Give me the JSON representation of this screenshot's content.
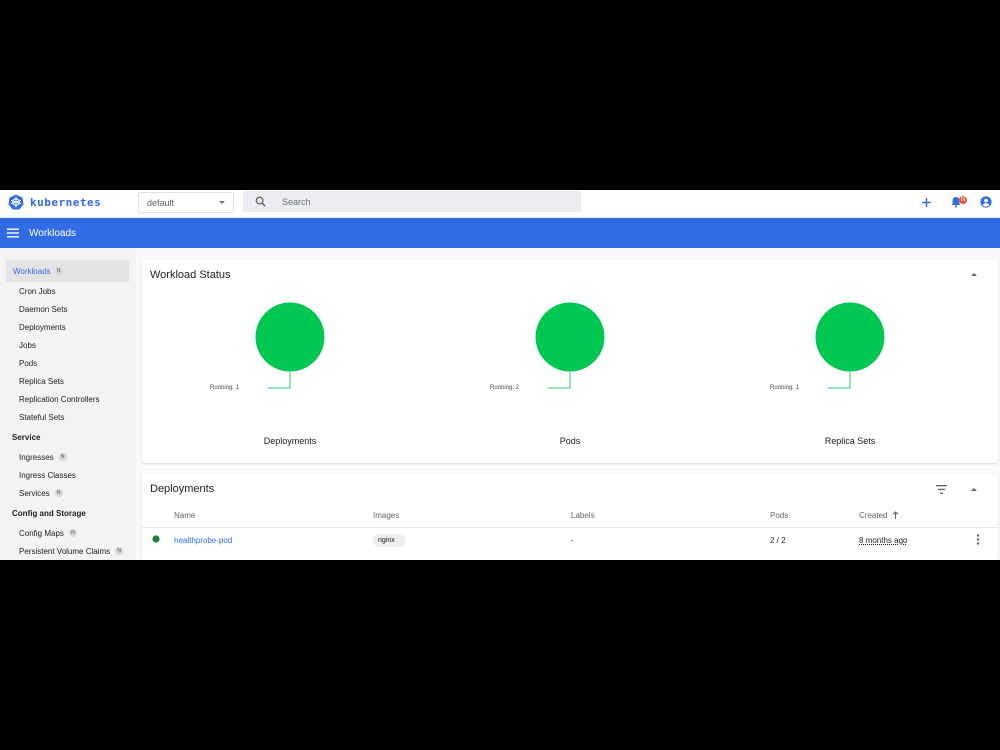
{
  "brand": {
    "name": "kubernetes",
    "color": "#326ce5"
  },
  "namespace": {
    "selected": "default"
  },
  "search": {
    "placeholder": "Search"
  },
  "header": {
    "actions": [
      "plus-icon",
      "notification-icon",
      "account-icon"
    ],
    "notification_badge": "N"
  },
  "appbar": {
    "title": "Workloads"
  },
  "sidebar": {
    "active": {
      "label": "Workloads",
      "badge": "N"
    },
    "workloads": [
      "Cron Jobs",
      "Daemon Sets",
      "Deployments",
      "Jobs",
      "Pods",
      "Replica Sets",
      "Replication Controllers",
      "Stateful Sets"
    ],
    "service": {
      "title": "Service",
      "items": [
        {
          "label": "Ingresses",
          "badge": "N"
        },
        {
          "label": "Ingress Classes",
          "badge": ""
        },
        {
          "label": "Services",
          "badge": "N"
        }
      ]
    },
    "config": {
      "title": "Config and Storage",
      "items": [
        {
          "label": "Config Maps",
          "badge": "N"
        },
        {
          "label": "Persistent Volume Claims",
          "badge": "N"
        }
      ]
    }
  },
  "workload_status": {
    "title": "Workload Status",
    "charts": [
      {
        "label": "Deployments",
        "running": "Running: 1",
        "color": "#00c752"
      },
      {
        "label": "Pods",
        "running": "Running: 2",
        "color": "#00c752"
      },
      {
        "label": "Replica Sets",
        "running": "Running: 1",
        "color": "#00c752"
      }
    ]
  },
  "deployments": {
    "title": "Deployments",
    "columns": {
      "name": "Name",
      "images": "Images",
      "labels": "Labels",
      "pods": "Pods",
      "created": "Created"
    },
    "rows": [
      {
        "status_color": "#188038",
        "name": "healthprobe-pod",
        "image": "nginx",
        "labels": "-",
        "pods": "2 / 2",
        "created": "8 months ago"
      }
    ]
  }
}
